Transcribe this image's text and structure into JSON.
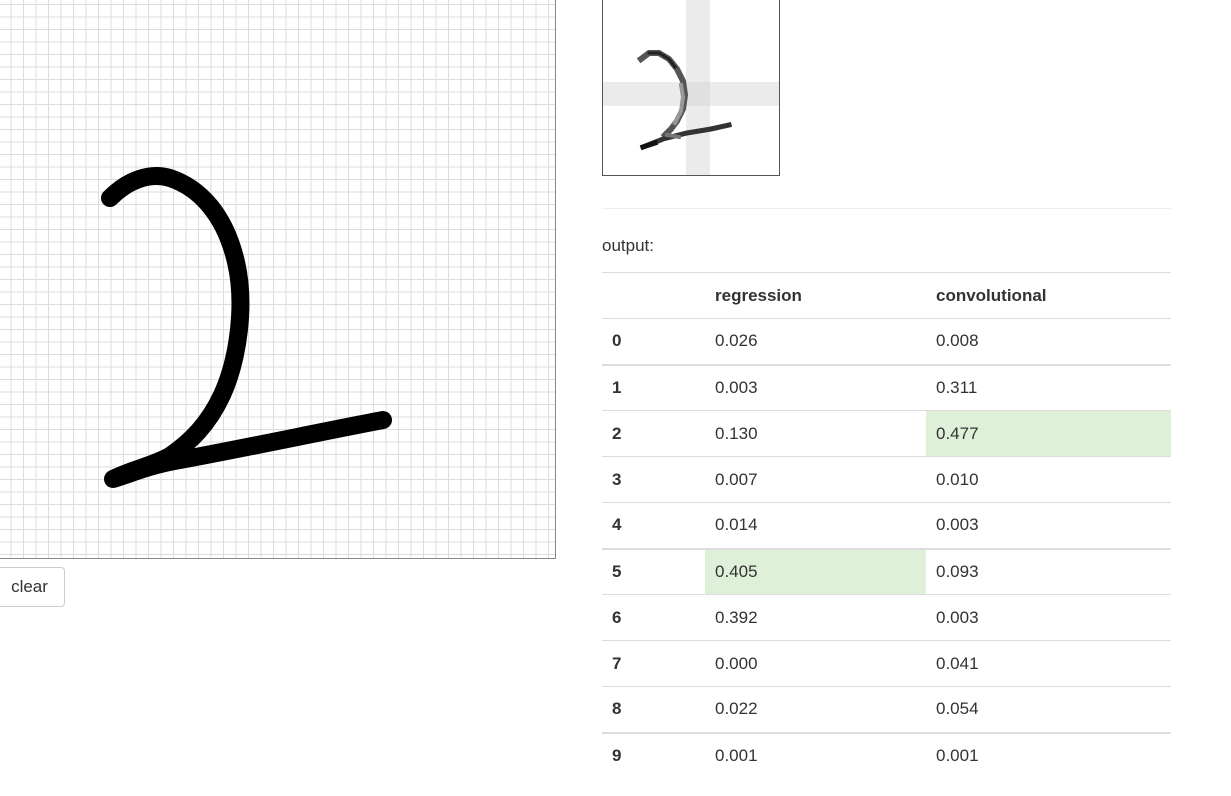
{
  "canvas": {
    "stroke_color": "#000000",
    "grid_color": "#dcdcdc"
  },
  "controls": {
    "clear_label": "clear"
  },
  "output": {
    "label": "output:",
    "columns": [
      "",
      "regression",
      "convolutional"
    ],
    "highlight_color": "#dff0d8",
    "rows": [
      {
        "digit": "0",
        "regression": "0.026",
        "convolutional": "0.008"
      },
      {
        "digit": "1",
        "regression": "0.003",
        "convolutional": "0.311"
      },
      {
        "digit": "2",
        "regression": "0.130",
        "convolutional": "0.477"
      },
      {
        "digit": "3",
        "regression": "0.007",
        "convolutional": "0.010"
      },
      {
        "digit": "4",
        "regression": "0.014",
        "convolutional": "0.003"
      },
      {
        "digit": "5",
        "regression": "0.405",
        "convolutional": "0.093"
      },
      {
        "digit": "6",
        "regression": "0.392",
        "convolutional": "0.003"
      },
      {
        "digit": "7",
        "regression": "0.000",
        "convolutional": "0.041"
      },
      {
        "digit": "8",
        "regression": "0.022",
        "convolutional": "0.054"
      },
      {
        "digit": "9",
        "regression": "0.001",
        "convolutional": "0.001"
      }
    ]
  }
}
